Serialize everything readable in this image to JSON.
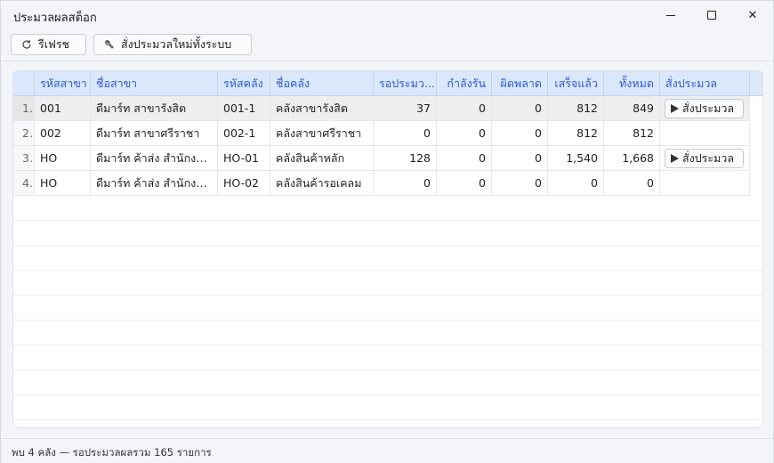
{
  "window": {
    "title": "ประมวลผลสต็อก",
    "minimize_icon": "minimize-icon",
    "maximize_icon": "maximize-icon",
    "close_glyph": "✕"
  },
  "toolbar": {
    "refresh_label": "รีเฟรช",
    "reprocess_label": "สั่งประมวลใหม่ทั้งระบบ"
  },
  "grid": {
    "columns": [
      "รหัสสาขา",
      "ชื่อสาขา",
      "รหัสคลัง",
      "ชื่อคลัง",
      "รอประมว...",
      "กำลังรัน",
      "ผิดพลาด",
      "เสร็จแล้ว",
      "ทั้งหมด",
      "สั่งประมวล"
    ],
    "action_label": "สั่งประมวล",
    "rows": [
      {
        "no": "1",
        "branch_code": "001",
        "branch_name": "ดีมาร์ท สาขารังสิต",
        "wh_code": "001-1",
        "wh_name": "คลังสาขารังสิต",
        "pending": "37",
        "running": "0",
        "error": "0",
        "done": "812",
        "total": "849",
        "has_action": true,
        "selected": true
      },
      {
        "no": "2",
        "branch_code": "002",
        "branch_name": "ดีมาร์ท สาขาศรีราชา",
        "wh_code": "002-1",
        "wh_name": "คลังสาขาศรีราชา",
        "pending": "0",
        "running": "0",
        "error": "0",
        "done": "812",
        "total": "812",
        "has_action": false,
        "selected": false
      },
      {
        "no": "3",
        "branch_code": "HO",
        "branch_name": "ดีมาร์ท ค้าส่ง สำนักงา...",
        "wh_code": "HO-01",
        "wh_name": "คลังสินค้าหลัก",
        "pending": "128",
        "running": "0",
        "error": "0",
        "done": "1,540",
        "total": "1,668",
        "has_action": true,
        "selected": false
      },
      {
        "no": "4",
        "branch_code": "HO",
        "branch_name": "ดีมาร์ท ค้าส่ง สำนักงา...",
        "wh_code": "HO-02",
        "wh_name": "คลังสินค้ารอเคลม",
        "pending": "0",
        "running": "0",
        "error": "0",
        "done": "0",
        "total": "0",
        "has_action": false,
        "selected": false
      }
    ]
  },
  "status": {
    "text": "พบ 4 คลัง — รอประมวลผลรวม 165 รายการ"
  },
  "colors": {
    "header_bg": "#dbe7fb",
    "header_text": "#2a5bd7",
    "selected_row": "#eeeeee"
  }
}
